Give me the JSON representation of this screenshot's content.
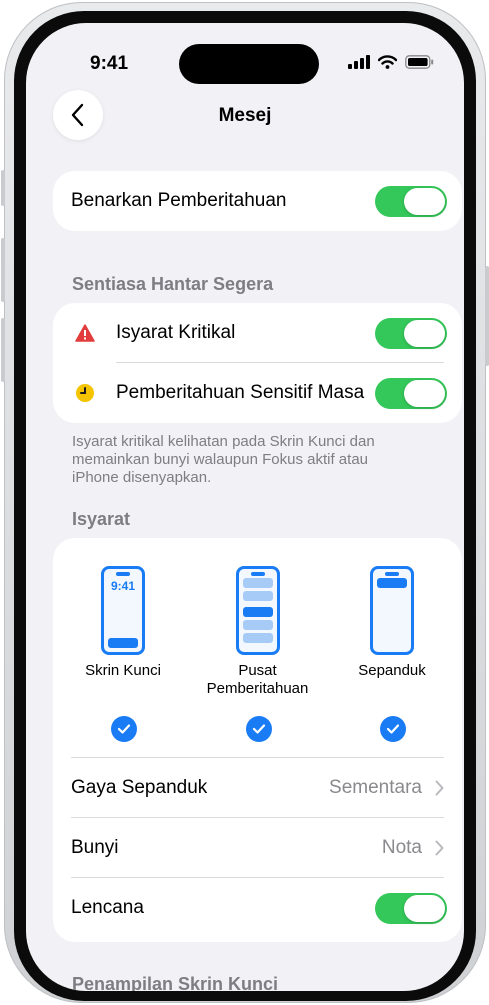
{
  "status": {
    "time": "9:41"
  },
  "nav": {
    "title": "Mesej"
  },
  "allow": {
    "label": "Benarkan Pemberitahuan"
  },
  "immediate": {
    "header": "Sentiasa Hantar Segera",
    "items": [
      {
        "label": "Isyarat Kritikal",
        "icon": "warning-triangle-icon",
        "icon_color": "#e23c3c"
      },
      {
        "label": "Pemberitahuan Sensitif Masa",
        "icon": "clock-icon",
        "icon_color": "#f5c400"
      }
    ],
    "footnote": "Isyarat kritikal kelihatan pada Skrin Kunci dan memainkan bunyi walaupun Fokus aktif atau iPhone disenyapkan."
  },
  "alerts": {
    "header": "Isyarat",
    "styles": [
      {
        "label": "Skrin Kunci",
        "preview_time": "9:41"
      },
      {
        "label": "Pusat Pemberitahuan"
      },
      {
        "label": "Sepanduk"
      }
    ],
    "banner_style": {
      "label": "Gaya Sepanduk",
      "value": "Sementara"
    },
    "sound": {
      "label": "Bunyi",
      "value": "Nota"
    },
    "badges": {
      "label": "Lencana"
    }
  },
  "lock_screen": {
    "header": "Penampilan Skrin Kunci"
  },
  "colors": {
    "accent": "#1a7cf5",
    "toggle_on": "#34c759",
    "background": "#f1f1f6"
  }
}
